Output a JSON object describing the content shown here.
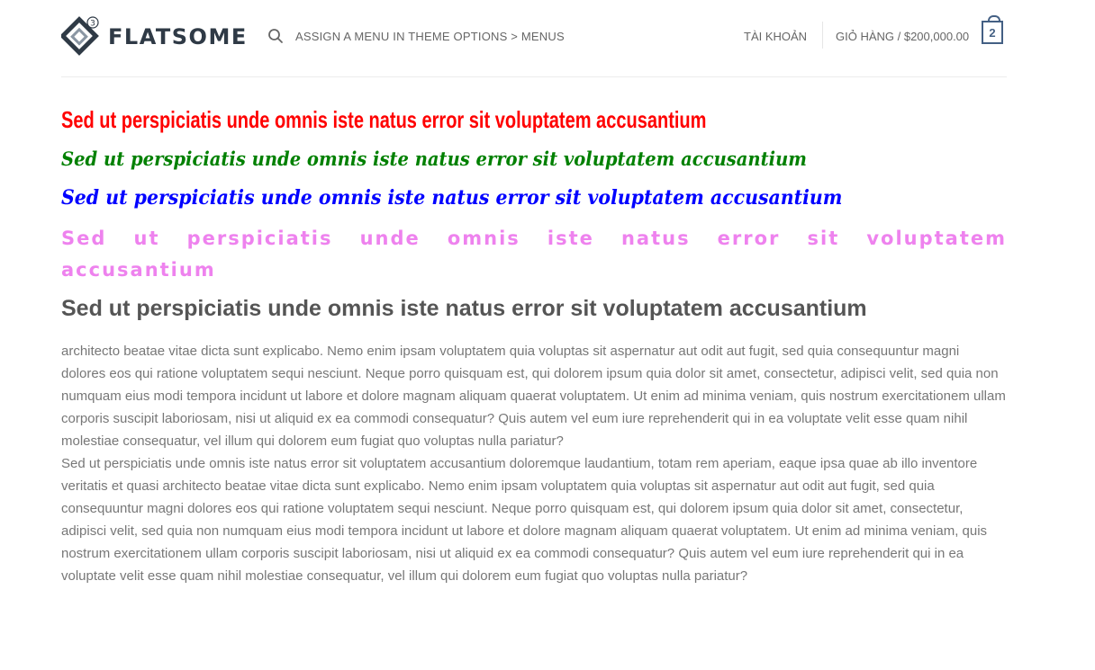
{
  "header": {
    "logo_text": "FLATSOME",
    "logo_badge": "3",
    "menu_hint": "ASSIGN A MENU IN THEME OPTIONS > MENUS",
    "account_label": "TÀI KHOẢN",
    "cart_label": "GIỎ HÀNG / $200,000.00",
    "cart_count": "2",
    "icons": {
      "search": "search-icon",
      "cart": "shopping-bag-icon"
    },
    "brand_color": "#446084"
  },
  "headings": {
    "h1": {
      "text": "Sed ut perspiciatis unde omnis iste natus error sit voluptatem accusantium",
      "color": "#ff0000"
    },
    "h2": {
      "text": "Sed ut perspiciatis unde omnis iste natus error sit voluptatem accusantium",
      "color": "#008000"
    },
    "h3": {
      "text": "Sed ut perspiciatis unde omnis iste natus error sit voluptatem accusantium",
      "color": "#0000ff"
    },
    "h4": {
      "text": "Sed ut perspiciatis unde omnis iste natus error sit voluptatem accusantium",
      "color": "#ee82ee"
    },
    "h5": {
      "text": "Sed ut perspiciatis unde omnis iste natus error sit voluptatem accusantium",
      "color": "#555555"
    }
  },
  "paragraphs": [
    "architecto beatae vitae dicta sunt explicabo. Nemo enim ipsam voluptatem quia voluptas sit aspernatur aut odit aut fugit, sed quia consequuntur magni dolores eos qui ratione voluptatem sequi nesciunt. Neque porro quisquam est, qui dolorem ipsum quia dolor sit amet, consectetur, adipisci velit, sed quia non numquam eius modi tempora incidunt ut labore et dolore magnam aliquam quaerat voluptatem. Ut enim ad minima veniam, quis nostrum exercitationem ullam corporis suscipit laboriosam, nisi ut aliquid ex ea commodi consequatur? Quis autem vel eum iure reprehenderit qui in ea voluptate velit esse quam nihil molestiae consequatur, vel illum qui dolorem eum fugiat quo voluptas nulla pariatur?",
    "Sed ut perspiciatis unde omnis iste natus error sit voluptatem accusantium doloremque laudantium, totam rem aperiam, eaque ipsa quae ab illo inventore veritatis et quasi architecto beatae vitae dicta sunt explicabo. Nemo enim ipsam voluptatem quia voluptas sit aspernatur aut odit aut fugit, sed quia consequuntur magni dolores eos qui ratione voluptatem sequi nesciunt. Neque porro quisquam est, qui dolorem ipsum quia dolor sit amet, consectetur, adipisci velit, sed quia non numquam eius modi tempora incidunt ut labore et dolore magnam aliquam quaerat voluptatem. Ut enim ad minima veniam, quis nostrum exercitationem ullam corporis suscipit laboriosam, nisi ut aliquid ex ea commodi consequatur? Quis autem vel eum iure reprehenderit qui in ea voluptate velit esse quam nihil molestiae consequatur, vel illum qui dolorem eum fugiat quo voluptas nulla pariatur?"
  ]
}
